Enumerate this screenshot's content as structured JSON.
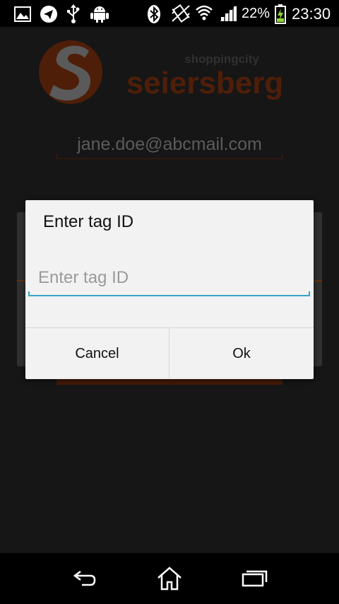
{
  "status_bar": {
    "icons": [
      "gallery-icon",
      "telegram-icon",
      "usb-icon",
      "android-icon",
      "bluetooth-icon",
      "vibrate-icon",
      "wifi-icon",
      "signal-icon",
      "battery-charging-icon"
    ],
    "battery_percent": "22%",
    "time": "23:30"
  },
  "app": {
    "logo": {
      "small_text": "shoppingcity",
      "large_text": "seiersberg",
      "emblem_letter": "S"
    },
    "email": "jane.doe@abcmail.com"
  },
  "dialog": {
    "title": "Enter tag ID",
    "input_placeholder": "Enter tag ID",
    "input_value": "",
    "cancel_label": "Cancel",
    "ok_label": "Ok"
  },
  "nav_bar": {
    "buttons": [
      "back-icon",
      "home-icon",
      "recents-icon"
    ]
  },
  "colors": {
    "brand_orange": "#8a3512",
    "input_accent": "#33a6c8",
    "dialog_bg": "#f2f2f2"
  }
}
